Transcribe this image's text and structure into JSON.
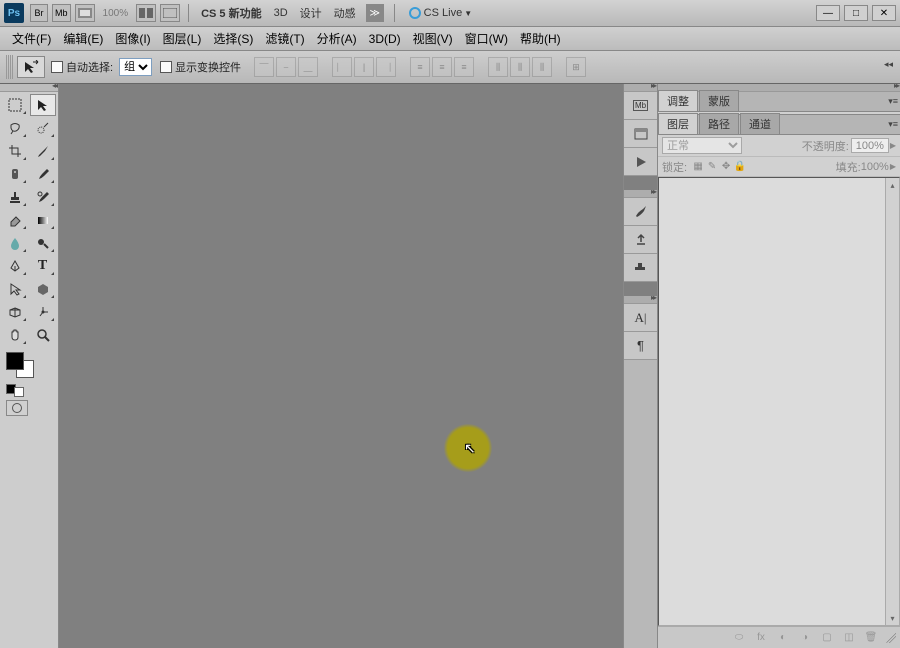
{
  "titlebar": {
    "ps": "Ps",
    "br": "Br",
    "mb": "Mb",
    "zoom": "100%",
    "cs5_label": "CS 5 新功能",
    "d3_label": "3D",
    "design_label": "设计",
    "motion_label": "动感",
    "cslive": "CS Live",
    "min": "—",
    "max": "□",
    "close": "✕"
  },
  "menu": {
    "file": "文件(F)",
    "edit": "编辑(E)",
    "image": "图像(I)",
    "layer": "图层(L)",
    "select": "选择(S)",
    "filter": "滤镜(T)",
    "analysis": "分析(A)",
    "d3": "3D(D)",
    "view": "视图(V)",
    "window": "窗口(W)",
    "help": "帮助(H)"
  },
  "options": {
    "auto_select": "自动选择:",
    "group": "组",
    "show_transform": "显示变换控件"
  },
  "dock": {
    "mb": "Mb"
  },
  "panels": {
    "adjust": "调整",
    "masks": "蒙版",
    "layers": "图层",
    "paths": "路径",
    "channels": "通道",
    "blend_mode": "正常",
    "opacity_label": "不透明度:",
    "opacity_value": "100%",
    "lock_label": "锁定:",
    "fill_label": "填充:",
    "fill_value": "100%"
  }
}
